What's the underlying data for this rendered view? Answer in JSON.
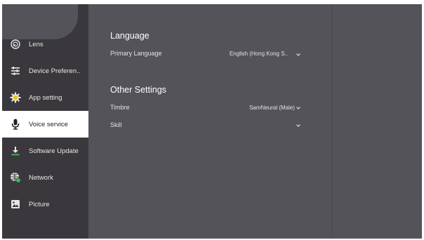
{
  "sidebar": {
    "items": [
      {
        "label": "Lens",
        "icon": "lens-icon"
      },
      {
        "label": "Device Preferen..",
        "icon": "sliders-icon"
      },
      {
        "label": "App setting",
        "icon": "app-gear-icon"
      },
      {
        "label": "Voice service",
        "icon": "microphone-icon",
        "active": true
      },
      {
        "label": "Software Update",
        "icon": "download-icon"
      },
      {
        "label": "Network",
        "icon": "network-globe-icon"
      },
      {
        "label": "Picture",
        "icon": "picture-icon"
      }
    ]
  },
  "main": {
    "language_section": {
      "title": "Language",
      "primary_language_label": "Primary Language",
      "primary_language_value": "English (Hong Kong S.."
    },
    "other_section": {
      "title": "Other Settings",
      "timbre_label": "Timbre",
      "timbre_value": "SamNeural (Male)",
      "skill_label": "Skill",
      "skill_value": ""
    }
  },
  "colors": {
    "background": "#545359",
    "sidebar": "#3a383c",
    "active_item": "#ffffff",
    "accent_yellow": "#f2c200",
    "accent_green": "#3fb950"
  }
}
